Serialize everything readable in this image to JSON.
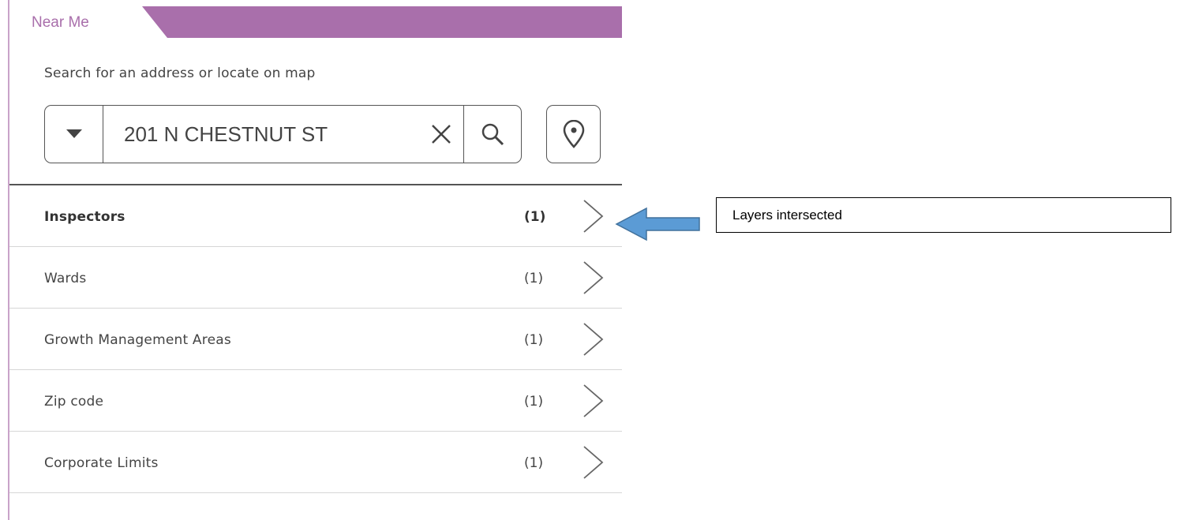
{
  "tab": {
    "label": "Near Me"
  },
  "search": {
    "prompt": "Search for an address or locate on map",
    "value": "201 N CHESTNUT ST",
    "dropdown_icon": "caret-down-icon",
    "clear_icon": "close-icon",
    "search_icon": "search-icon",
    "locate_icon": "location-pin-icon"
  },
  "results": [
    {
      "name": "Inspectors",
      "count": "(1)",
      "bold": true
    },
    {
      "name": "Wards",
      "count": "(1)",
      "bold": false
    },
    {
      "name": "Growth Management Areas",
      "count": "(1)",
      "bold": false
    },
    {
      "name": "Zip code",
      "count": "(1)",
      "bold": false
    },
    {
      "name": "Corporate Limits",
      "count": "(1)",
      "bold": false
    }
  ],
  "annotation": {
    "text": "Layers intersected"
  },
  "colors": {
    "accent": "#a96fab",
    "arrow_fill": "#5b9bd5",
    "arrow_stroke": "#41719c"
  }
}
